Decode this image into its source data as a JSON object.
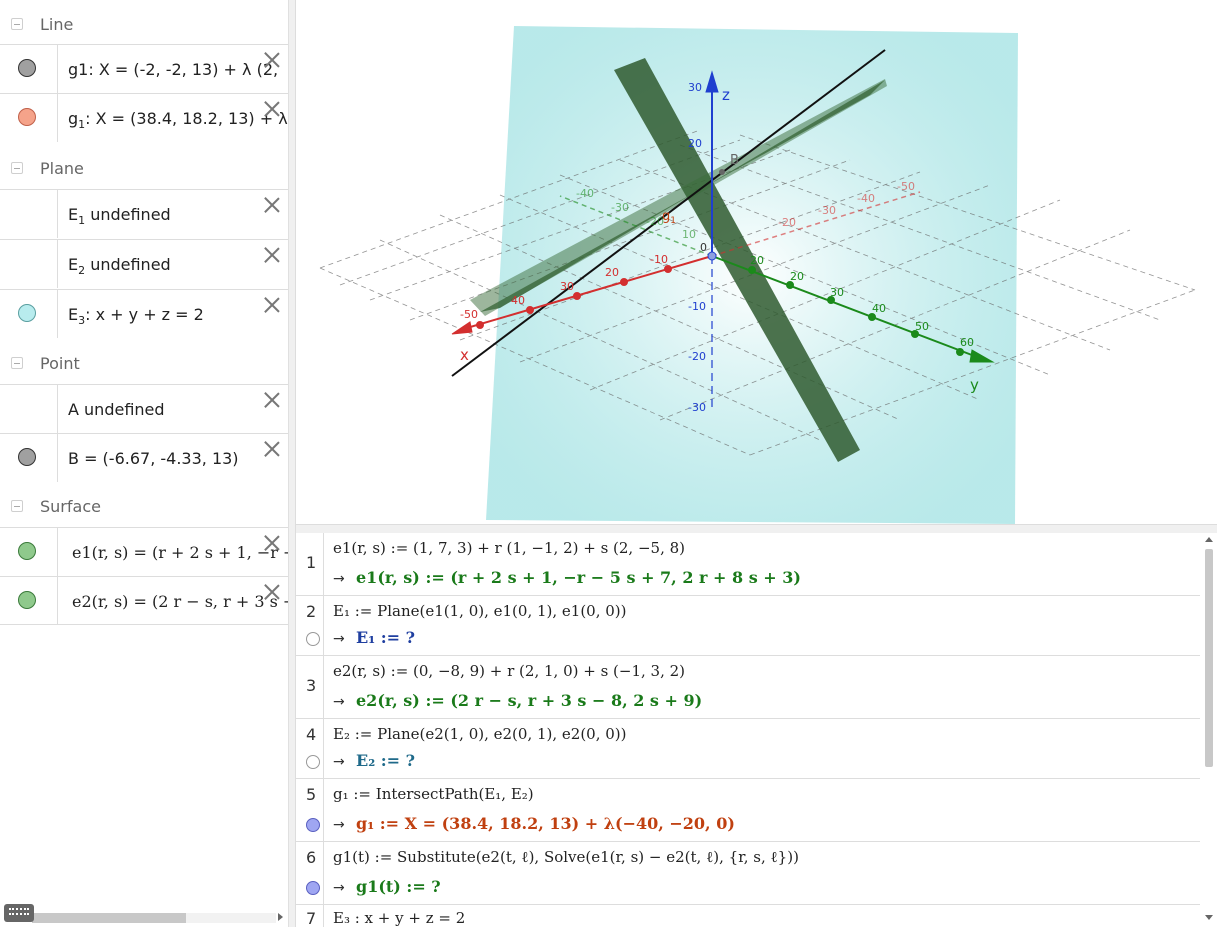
{
  "algebra": {
    "categories": {
      "line": "Line",
      "plane": "Plane",
      "point": "Point",
      "surface": "Surface"
    },
    "items": [
      {
        "main": "g1: X = (-2, -2, 13) + λ (2,",
        "color": "#a0a0a0"
      },
      {
        "prefix": "g",
        "sub": "1",
        "main": ": X = (38.4, 18.2, 13) + λ",
        "color": "#f5a38a"
      },
      {
        "prefix": "E",
        "sub": "1",
        "main": " undefined",
        "color": ""
      },
      {
        "prefix": "E",
        "sub": "2",
        "main": " undefined",
        "color": ""
      },
      {
        "prefix": "E",
        "sub": "3",
        "main": ": x + y + z = 2",
        "color": "#b8ecee"
      },
      {
        "main": "A undefined",
        "color": ""
      },
      {
        "main": "B = (-6.67, -4.33, 13)",
        "color": "#a0a0a0"
      },
      {
        "main": "e1(r, s) = (r + 2 s + 1, −r − 5",
        "color": "#8fc98c"
      },
      {
        "main": "e2(r, s) = (2 r − s, r + 3 s − 8",
        "color": "#8fc98c"
      }
    ]
  },
  "graphics": {
    "axes": {
      "x_label": "x",
      "y_label": "y",
      "z_label": "z",
      "x_ticks": [
        "-50",
        "40",
        "30",
        "20",
        "-10"
      ],
      "y_ticks": [
        "20",
        "20",
        "30",
        "40",
        "50",
        "60"
      ],
      "z_ticks": [
        "30",
        "20",
        "-10",
        "-20",
        "-30"
      ],
      "back_x_ticks": [
        "-20",
        "-30",
        "-40",
        "-50"
      ],
      "back_y_ticks": [
        "-40",
        "-30",
        "-20",
        "10"
      ],
      "origin": "0",
      "point_b": "B",
      "line_label": "g",
      "line_label_sub": "1"
    },
    "colors": {
      "x_axis": "#d32f2f",
      "y_axis": "#1b8a1b",
      "z_axis": "#1f3fcf",
      "plane": "#7fd7d8",
      "surface": "#2f5a2f"
    }
  },
  "cas": {
    "rows": [
      {
        "num": "1",
        "input": "e1(r, s) := (1, 7, 3) + r (1, −1, 2) + s (2, −5, 8)",
        "arrow": "→",
        "output": "e1(r, s) := (r + 2 s + 1, −r − 5 s + 7, 2 r + 8 s + 3)",
        "color": "#1a7a1a",
        "marble": ""
      },
      {
        "num": "2",
        "input": "E₁ := Plane(e1(1, 0), e1(0, 1), e1(0, 0))",
        "arrow": "→",
        "output": "E₁ := ?",
        "color": "#1f3fa0",
        "marble": "empty"
      },
      {
        "num": "3",
        "input": "e2(r, s) := (0, −8, 9) + r (2, 1, 0) + s (−1, 3, 2)",
        "arrow": "→",
        "output": "e2(r, s) := (2 r − s, r + 3 s − 8, 2 s + 9)",
        "color": "#1a7a1a",
        "marble": ""
      },
      {
        "num": "4",
        "input": "E₂ := Plane(e2(1, 0), e2(0, 1), e2(0, 0))",
        "arrow": "→",
        "output": "E₂ := ?",
        "color": "#1f6a8a",
        "marble": "empty"
      },
      {
        "num": "5",
        "input": "g₁ := IntersectPath(E₁, E₂)",
        "arrow": "→",
        "output": "g₁ := X = (38.4, 18.2, 13) + λ(−40, −20, 0)",
        "color": "#c04010",
        "marble": "filled"
      },
      {
        "num": "6",
        "input": "g1(t) := Substitute(e2(t, ℓ), Solve(e1(r, s) − e2(t, ℓ), {r, s, ℓ}))",
        "arrow": "→",
        "output": "g1(t) := ?",
        "color": "#1a7a1a",
        "marble": "filled"
      },
      {
        "num": "7",
        "input": "E₃ : x + y + z = 2",
        "arrow": "",
        "output": "",
        "color": "#222",
        "marble": ""
      }
    ]
  }
}
